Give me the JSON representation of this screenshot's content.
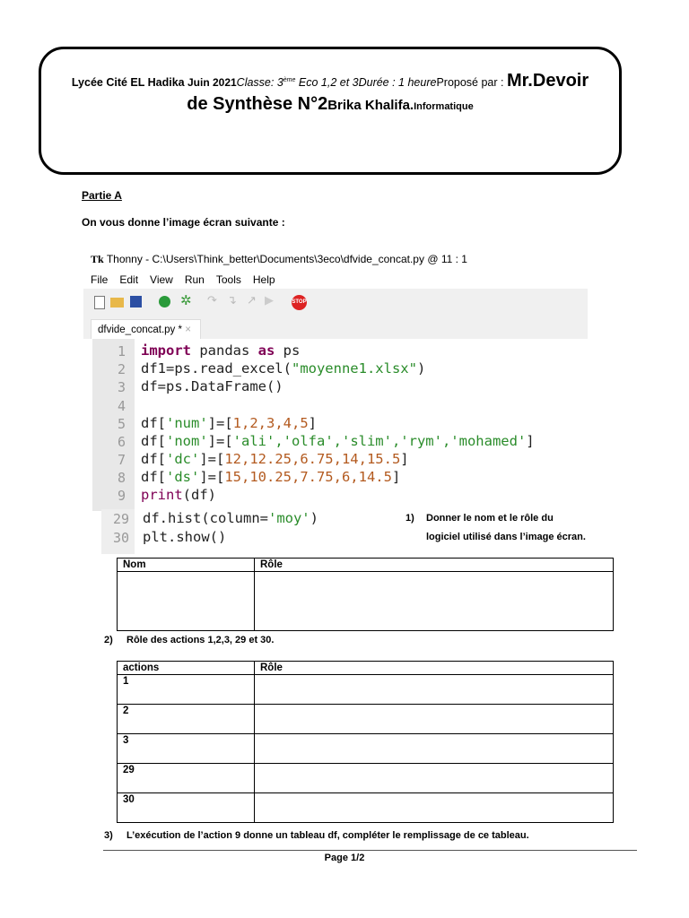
{
  "header": {
    "school": "Lycée Cité EL Hadika",
    "date": " Juin 2021",
    "classe": "Classe: 3",
    "classe_sup": "ème",
    "classe_rest": "  Eco 1,2 et 3Durée : 1 heure",
    "propose": "Proposé par : ",
    "mr": "Mr.",
    "devoir": "Devoir",
    "line2a": "de Synthèse N°2",
    "author": "Brika Khalifa.",
    "subject": "Informatique"
  },
  "partie": "Partie A",
  "intro": "On vous donne l’image écran suivante :",
  "ide": {
    "title": "Thonny  -  C:\\Users\\Think_better\\Documents\\3eco\\dfvide_concat.py  @  11 : 1",
    "menu": [
      "File",
      "Edit",
      "View",
      "Run",
      "Tools",
      "Help"
    ],
    "tab": "dfvide_concat.py *",
    "tab_close": "×",
    "stop": "STOP",
    "lines": [
      {
        "n": "1"
      },
      {
        "n": "2"
      },
      {
        "n": "3"
      },
      {
        "n": "4"
      },
      {
        "n": "5"
      },
      {
        "n": "6"
      },
      {
        "n": "7"
      },
      {
        "n": "8"
      },
      {
        "n": "9"
      }
    ],
    "code": {
      "l1a": "import",
      "l1b": " pandas ",
      "l1c": "as",
      "l1d": " ps",
      "l2a": "df1=ps.read_excel(",
      "l2b": "\"moyenne1.xlsx\"",
      "l2c": ")",
      "l3": "df=ps.DataFrame()",
      "l5a": "df[",
      "l5b": "'num'",
      "l5c": "]=[",
      "l5d": "1,2,3,4,5",
      "l5e": "]",
      "l6a": "df[",
      "l6b": "'nom'",
      "l6c": "]=[",
      "l6d": "'ali','olfa','slim','rym','mohamed'",
      "l6e": "]",
      "l7a": "df[",
      "l7b": "'dc'",
      "l7c": "]=[",
      "l7d": "12,12.25,6.75,14,15.5",
      "l7e": "]",
      "l8a": "df[",
      "l8b": "'ds'",
      "l8c": "]=[",
      "l8d": "15,10.25,7.75,6,14.5",
      "l8e": "]",
      "l9a": "print",
      "l9b": "(df)"
    },
    "n29": "29",
    "n30": "30",
    "l29a": "df.hist(column=",
    "l29b": "'moy'",
    "l29c": ")",
    "l30": "plt.show()"
  },
  "q1": {
    "num": "1)",
    "text1": "Donner le nom et le rôle du",
    "text2": "logiciel utilisé dans l’image écran."
  },
  "table1": {
    "headers": [
      "Nom",
      "Rôle"
    ]
  },
  "q2": {
    "num": "2)",
    "text": "Rôle des actions 1,2,3, 29 et 30."
  },
  "table2": {
    "headers": [
      "actions",
      "Rôle"
    ],
    "rows": [
      "1",
      "2",
      "3",
      "29",
      "30"
    ]
  },
  "q3": {
    "num": "3)",
    "text": "L’exécution de l’action 9 donne un tableau df, compléter le remplissage de ce tableau."
  },
  "footer": {
    "page": "Page 1/2"
  }
}
